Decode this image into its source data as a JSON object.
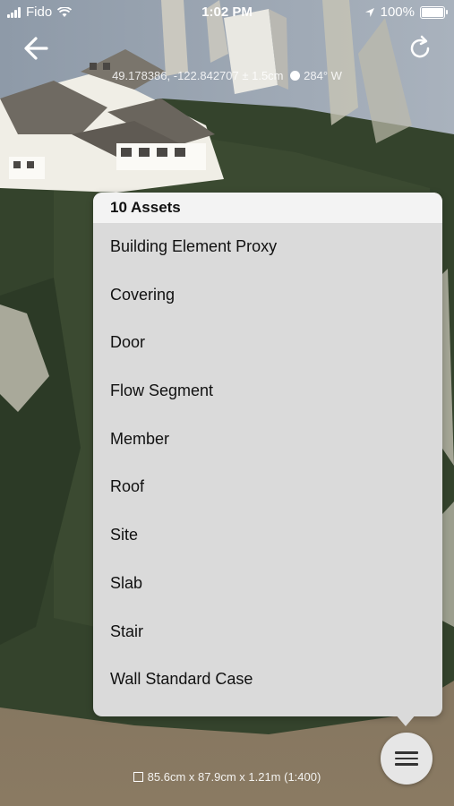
{
  "status_bar": {
    "carrier": "Fido",
    "time": "1:02 PM",
    "battery": "100%",
    "icons": [
      "signal-icon",
      "wifi-icon",
      "location-arrow-icon",
      "battery-icon"
    ]
  },
  "navigation": {
    "back_icon": "arrow-left-icon",
    "refresh_icon": "refresh-icon"
  },
  "location": {
    "coordinates": "49.178386, -122.842707",
    "altitude": "1.5cm",
    "heading": "284° W"
  },
  "assets_panel": {
    "title": "10 Assets",
    "items": [
      "Building Element Proxy",
      "Covering",
      "Door",
      "Flow Segment",
      "Member",
      "Roof",
      "Site",
      "Slab",
      "Stair",
      "Wall Standard Case"
    ]
  },
  "menu_button": {
    "icon": "hamburger-menu-icon"
  },
  "footer": {
    "dimensions": "85.6cm x 87.9cm x 1.21m (1:400)"
  },
  "colors": {
    "panel_bg": "#dadada",
    "panel_header_bg": "#f3f3f3",
    "terrain": "#34432c",
    "ground": "#7b6e5a"
  }
}
